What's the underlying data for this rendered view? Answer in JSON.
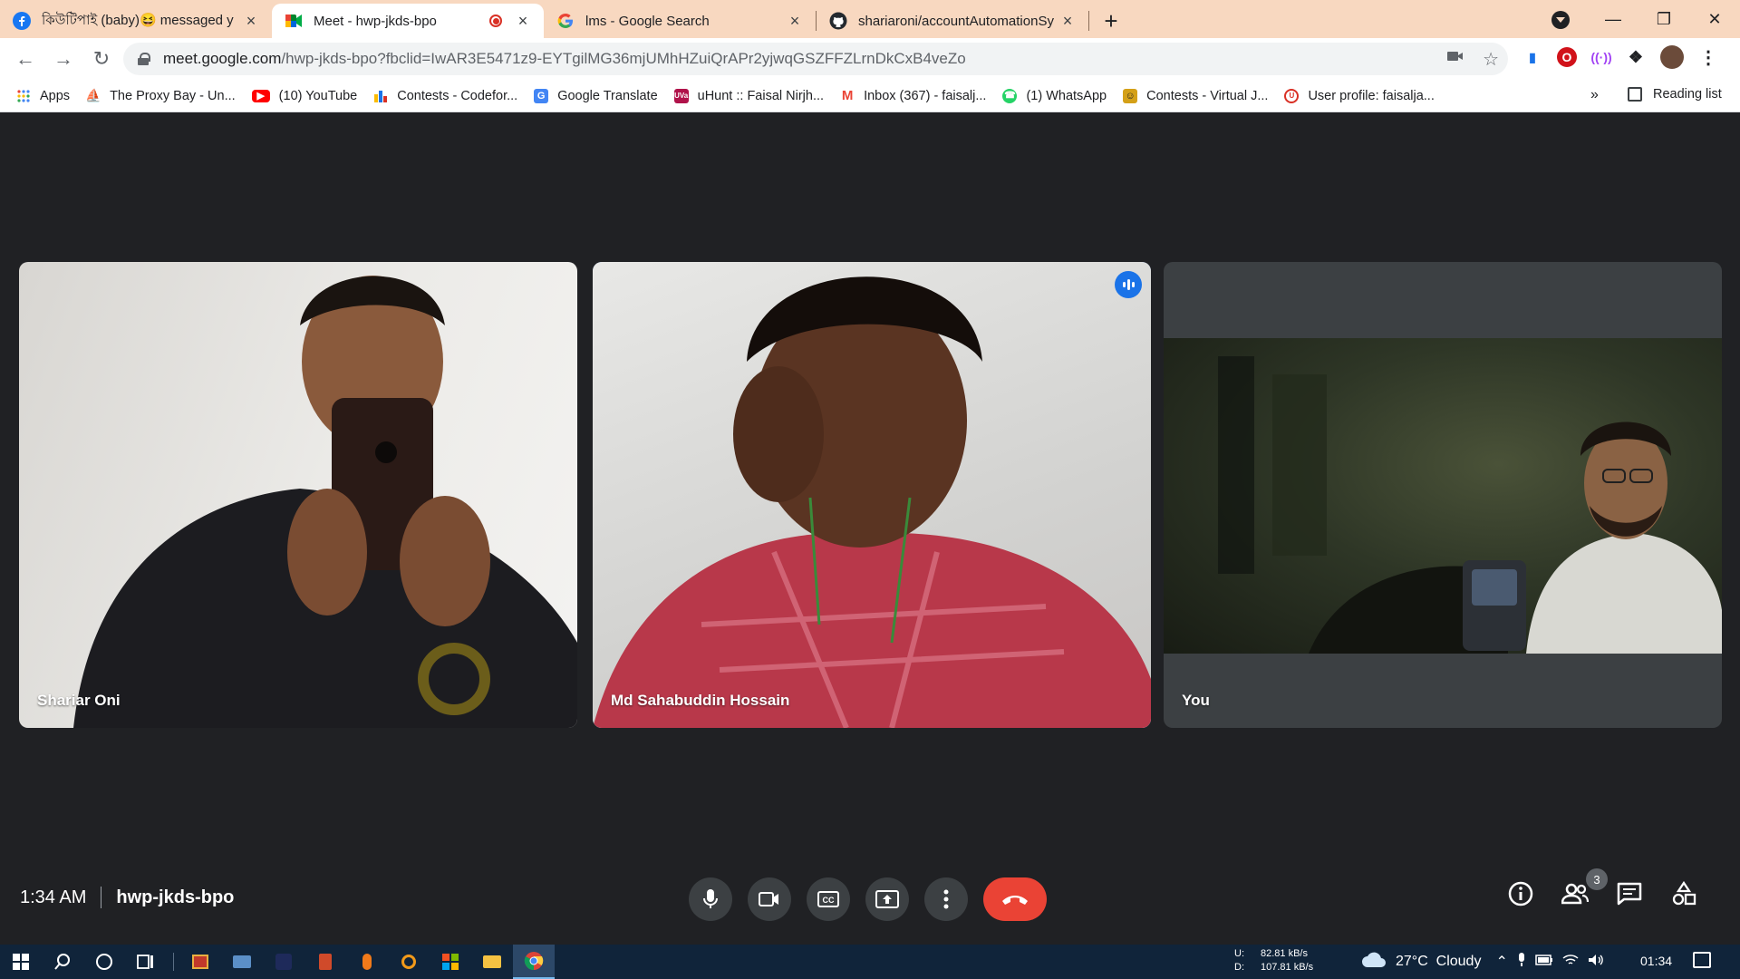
{
  "browser": {
    "tabs": [
      {
        "title": "কিউটিপাই (baby)😆 messaged y",
        "favicon": "facebook-icon",
        "active": false
      },
      {
        "title": "Meet - hwp-jkds-bpo",
        "favicon": "google-meet-icon",
        "active": true,
        "recording": true
      },
      {
        "title": "lms - Google Search",
        "favicon": "google-icon",
        "active": false
      },
      {
        "title": "shariaroni/accountAutomationSy",
        "favicon": "github-icon",
        "active": false
      }
    ],
    "new_tab_label": "+",
    "url_host": "meet.google.com",
    "url_rest": "/hwp-jkds-bpo?fbclid=IwAR3E5471z9-EYTgilMG36mjUMhHZuiQrAPr2yjwqGSZFFZLrnDkCxB4veZo",
    "bookmarks": [
      {
        "label": "Apps",
        "icon": "apps-grid-icon",
        "color": "#4285f4"
      },
      {
        "label": "The Proxy Bay - Un...",
        "icon": "pirate-ship-icon",
        "color": "#202124"
      },
      {
        "label": "(10) YouTube",
        "icon": "youtube-icon",
        "color": "#ff0000"
      },
      {
        "label": "Contests - Codefor...",
        "icon": "codeforces-icon",
        "color": "#1a73e8"
      },
      {
        "label": "Google Translate",
        "icon": "translate-icon",
        "color": "#4285f4"
      },
      {
        "label": "uHunt :: Faisal Nirjh...",
        "icon": "uva-icon",
        "color": "#b0124a"
      },
      {
        "label": "Inbox (367) - faisalj...",
        "icon": "gmail-icon",
        "color": "#ea4335"
      },
      {
        "label": "(1) WhatsApp",
        "icon": "whatsapp-icon",
        "color": "#25d366"
      },
      {
        "label": "Contests - Virtual J...",
        "icon": "vjudge-icon",
        "color": "#d4a017"
      },
      {
        "label": "User profile: faisalja...",
        "icon": "profile-badge-icon",
        "color": "#d93025"
      }
    ],
    "more_bookmarks": "»",
    "reading_list": "Reading list"
  },
  "meet": {
    "participants": [
      {
        "name": "Shariar Oni",
        "speaking": false
      },
      {
        "name": "Md Sahabuddin Hossain",
        "speaking": true
      },
      {
        "name": "You",
        "speaking": false
      }
    ],
    "time": "1:34 AM",
    "meeting_code": "hwp-jkds-bpo",
    "people_count": "3",
    "colors": {
      "accent": "#8ab4f8",
      "end_call": "#ea4335",
      "speaking_badge": "#1a73e8"
    }
  },
  "taskbar": {
    "net_up_label": "U:",
    "net_up": "82.81 kB/s",
    "net_down_label": "D:",
    "net_down": "107.81 kB/s",
    "weather": "27°C  Cloudy",
    "clock": "01:34"
  }
}
